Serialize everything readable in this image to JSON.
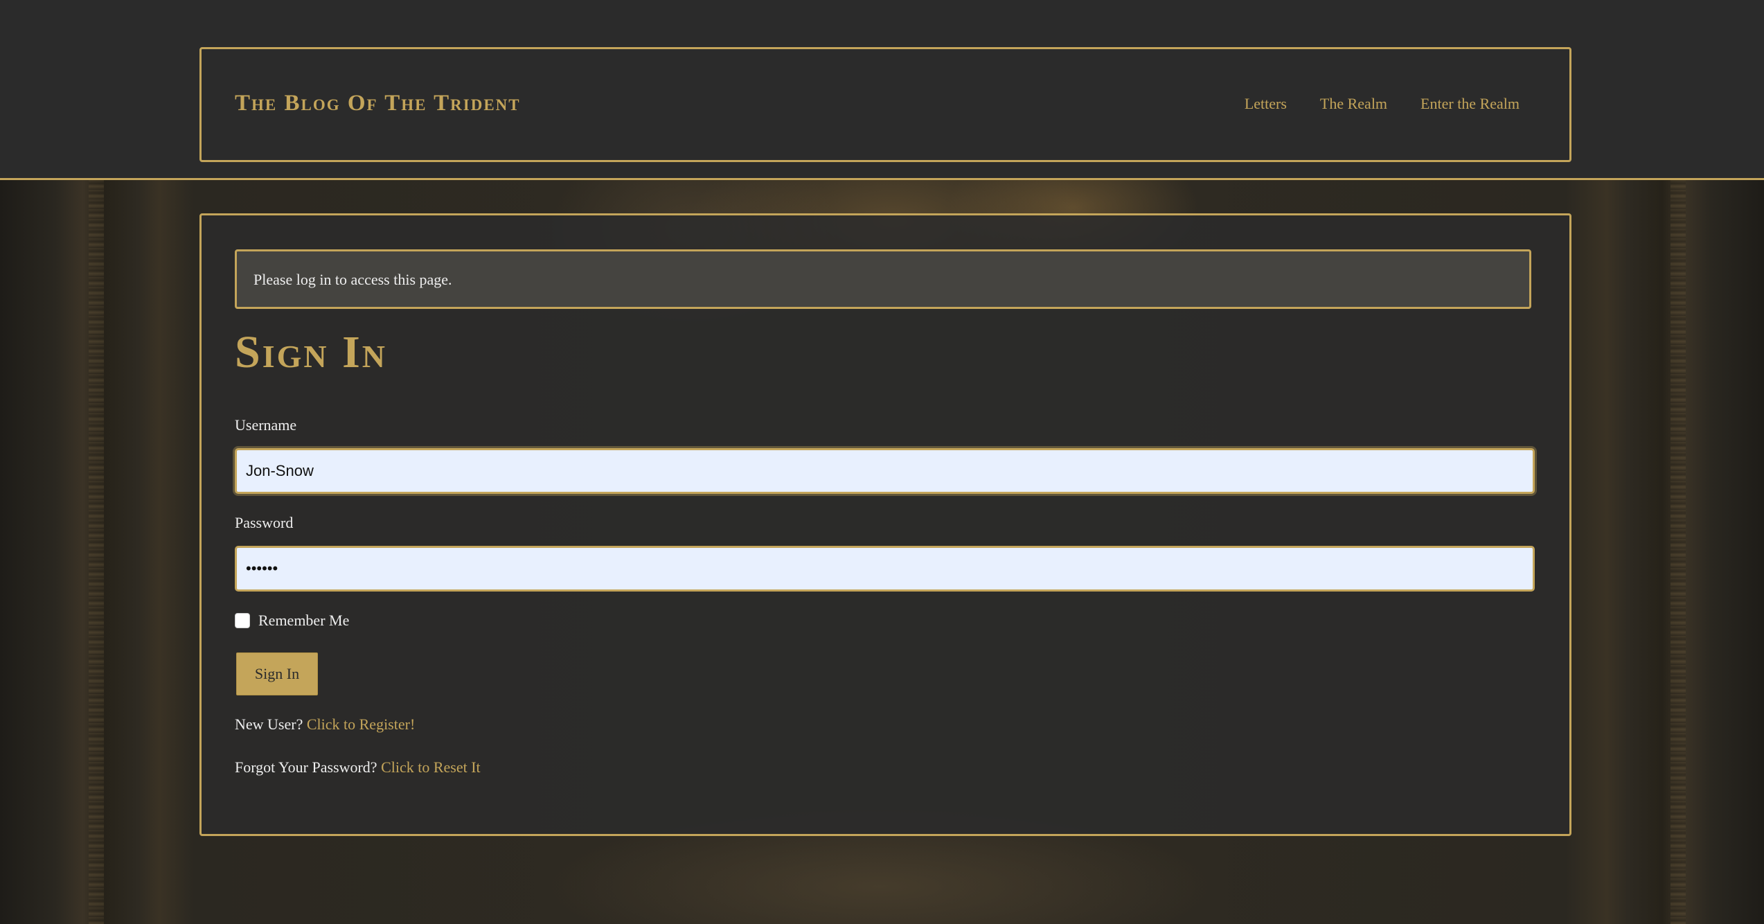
{
  "colors": {
    "accent": "#c4a55a",
    "background": "#2b2b2b",
    "text": "#eeeeee",
    "input_background": "#e8f0fe"
  },
  "header": {
    "brand": "The Blog Of The Trident",
    "nav": [
      {
        "label": "Letters"
      },
      {
        "label": "The Realm"
      },
      {
        "label": "Enter the Realm"
      }
    ]
  },
  "alert": {
    "message": "Please log in to access this page."
  },
  "form": {
    "title": "Sign In",
    "username_label": "Username",
    "username_value": "Jon-Snow",
    "password_label": "Password",
    "password_value": "••••••",
    "remember_label": "Remember Me",
    "remember_checked": false,
    "submit_label": "Sign In"
  },
  "links": {
    "register_prompt": "New User?",
    "register_link": "Click to Register!",
    "reset_prompt": "Forgot Your Password?",
    "reset_link": "Click to Reset It"
  }
}
